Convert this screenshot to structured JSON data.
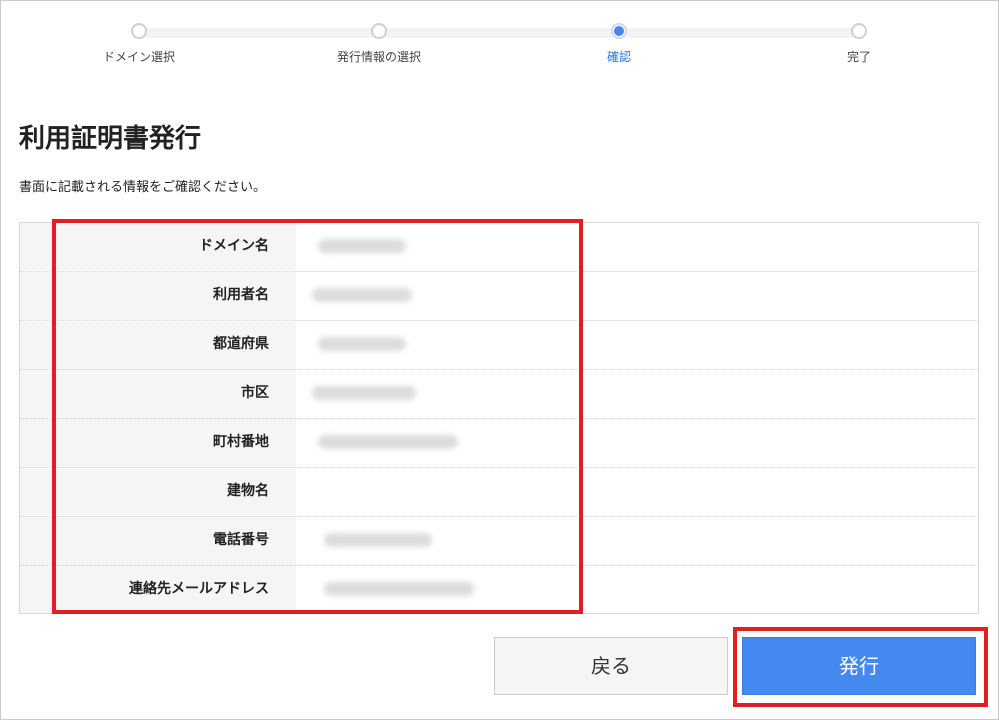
{
  "steps": [
    {
      "label": "ドメイン選択",
      "active": false
    },
    {
      "label": "発行情報の選択",
      "active": false
    },
    {
      "label": "確認",
      "active": true
    },
    {
      "label": "完了",
      "active": false
    }
  ],
  "title": "利用証明書発行",
  "description": "書面に記載される情報をご確認ください。",
  "rows": [
    {
      "label": "ドメイン名"
    },
    {
      "label": "利用者名"
    },
    {
      "label": "都道府県"
    },
    {
      "label": "市区"
    },
    {
      "label": "町村番地"
    },
    {
      "label": "建物名"
    },
    {
      "label": "電話番号"
    },
    {
      "label": "連絡先メールアドレス"
    }
  ],
  "buttons": {
    "back": "戻る",
    "issue": "発行"
  },
  "colors": {
    "accent": "#4489ef",
    "highlight": "#e21d25"
  }
}
